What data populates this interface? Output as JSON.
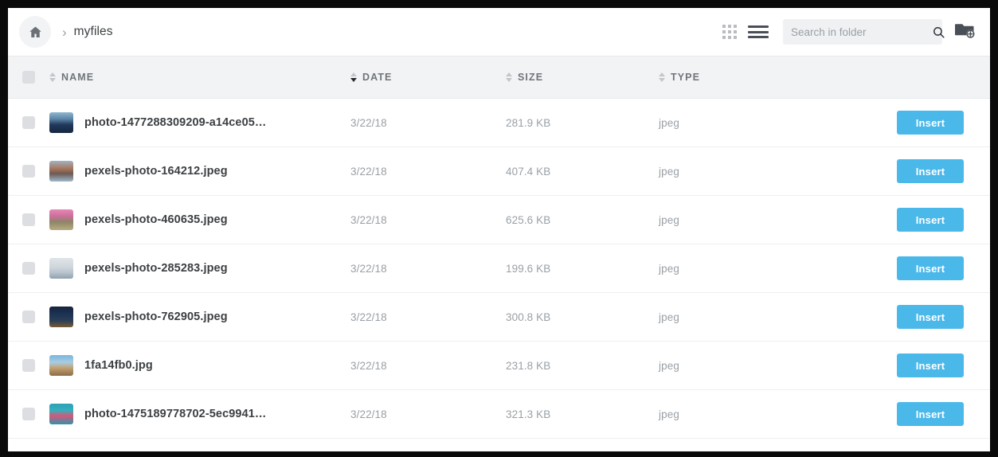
{
  "breadcrumb": {
    "home_icon": "home-icon",
    "separator": "›",
    "current_folder": "myfiles"
  },
  "toolbar": {
    "grid_view_icon": "grid-view-icon",
    "list_view_icon": "list-view-icon",
    "active_view": "list",
    "search": {
      "placeholder": "Search in folder",
      "value": "",
      "icon": "search-icon"
    },
    "new_folder_icon": "folder-add-icon"
  },
  "table": {
    "select_all_checked": false,
    "columns": [
      {
        "key": "name",
        "label": "NAME",
        "sort": "none"
      },
      {
        "key": "date",
        "label": "DATE",
        "sort": "desc"
      },
      {
        "key": "size",
        "label": "SIZE",
        "sort": "none"
      },
      {
        "key": "type",
        "label": "TYPE",
        "sort": "none"
      }
    ],
    "action_label": "Insert",
    "rows": [
      {
        "name": "photo-1477288309209-a14ce05…",
        "date": "3/22/18",
        "size": "281.9 KB",
        "type": "jpeg",
        "thumb": "bridge-over-blue-sea",
        "checked": false
      },
      {
        "name": "pexels-photo-164212.jpeg",
        "date": "3/22/18",
        "size": "407.4 KB",
        "type": "jpeg",
        "thumb": "venice-canal-buildings",
        "checked": false
      },
      {
        "name": "pexels-photo-460635.jpeg",
        "date": "3/22/18",
        "size": "625.6 KB",
        "type": "jpeg",
        "thumb": "cherry-blossom-stone-arch",
        "checked": false
      },
      {
        "name": "pexels-photo-285283.jpeg",
        "date": "3/22/18",
        "size": "199.6 KB",
        "type": "jpeg",
        "thumb": "pale-sky-towers",
        "checked": false
      },
      {
        "name": "pexels-photo-762905.jpeg",
        "date": "3/22/18",
        "size": "300.8 KB",
        "type": "jpeg",
        "thumb": "night-city-skyline",
        "checked": false
      },
      {
        "name": "1fa14fb0.jpg",
        "date": "3/22/18",
        "size": "231.8 KB",
        "type": "jpeg",
        "thumb": "wooden-boardwalk-sky",
        "checked": false
      },
      {
        "name": "photo-1475189778702-5ec9941…",
        "date": "3/22/18",
        "size": "321.3 KB",
        "type": "jpeg",
        "thumb": "teal-ocean-pink-bridge",
        "checked": false
      }
    ]
  },
  "colors": {
    "accent": "#4bb8ea",
    "header_bg": "#f2f3f5",
    "text_primary": "#3c4043",
    "text_muted": "#9aa0a6",
    "frame": "#0a0a0a"
  }
}
